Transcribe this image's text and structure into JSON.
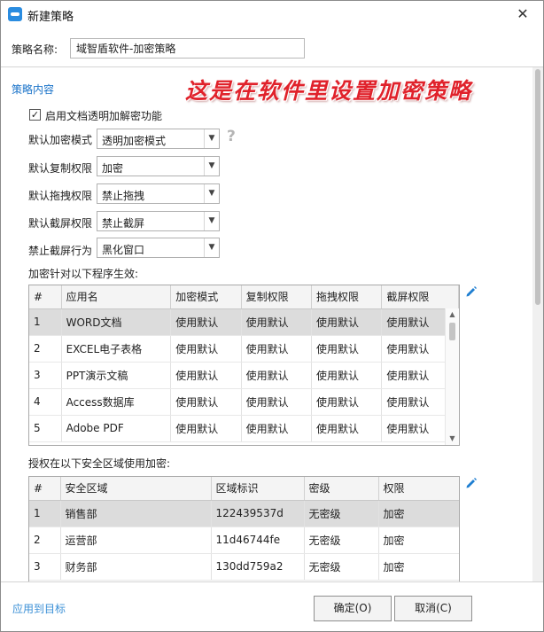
{
  "window": {
    "title": "新建策略",
    "close_glyph": "✕"
  },
  "policy_name": {
    "label": "策略名称:",
    "value": "域智盾软件-加密策略"
  },
  "section": {
    "title": "策略内容",
    "annotation": "这是在软件里设置加密策略",
    "annotation_color": "#e0222b"
  },
  "settings": {
    "enable_transparent": {
      "label": "启用文档透明加解密功能",
      "checked": true
    },
    "fields": [
      {
        "label": "默认加密模式",
        "value": "透明加密模式"
      },
      {
        "label": "默认复制权限",
        "value": "加密"
      },
      {
        "label": "默认拖拽权限",
        "value": "禁止拖拽"
      },
      {
        "label": "默认截屏权限",
        "value": "禁止截屏"
      },
      {
        "label": "禁止截屏行为",
        "value": "黑化窗口"
      }
    ],
    "help_glyph": "?"
  },
  "programs": {
    "caption": "加密针对以下程序生效:",
    "columns": [
      "#",
      "应用名",
      "加密模式",
      "复制权限",
      "拖拽权限",
      "截屏权限"
    ],
    "rows": [
      [
        "1",
        "WORD文档",
        "使用默认",
        "使用默认",
        "使用默认",
        "使用默认"
      ],
      [
        "2",
        "EXCEL电子表格",
        "使用默认",
        "使用默认",
        "使用默认",
        "使用默认"
      ],
      [
        "3",
        "PPT演示文稿",
        "使用默认",
        "使用默认",
        "使用默认",
        "使用默认"
      ],
      [
        "4",
        "Access数据库",
        "使用默认",
        "使用默认",
        "使用默认",
        "使用默认"
      ],
      [
        "5",
        "Adobe PDF",
        "使用默认",
        "使用默认",
        "使用默认",
        "使用默认"
      ]
    ],
    "selected_row": 0
  },
  "zones": {
    "caption": "授权在以下安全区域使用加密:",
    "columns": [
      "#",
      "安全区域",
      "区域标识",
      "密级",
      "权限"
    ],
    "rows": [
      [
        "1",
        "销售部",
        "122439537d",
        "无密级",
        "加密"
      ],
      [
        "2",
        "运营部",
        "11d46744fe",
        "无密级",
        "加密"
      ],
      [
        "3",
        "财务部",
        "130dd759a2",
        "无密级",
        "加密"
      ]
    ],
    "selected_row": 0
  },
  "footer": {
    "apply_link": "应用到目标",
    "ok_label": "确定(O)",
    "cancel_label": "取消(C)"
  },
  "colors": {
    "accent": "#1a73c9",
    "edit_icon": "#1f7fd1"
  },
  "icons": {
    "app": "app-logo-icon",
    "close": "close-icon",
    "dropdown": "chevron-down-icon",
    "help": "question-mark-icon",
    "edit": "pencil-icon"
  }
}
